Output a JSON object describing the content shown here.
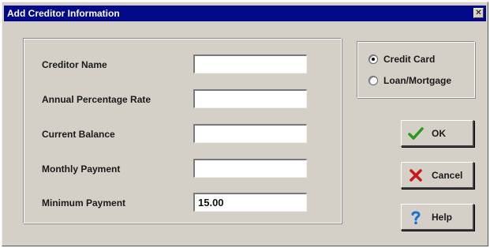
{
  "window": {
    "title": "Add Creditor Information",
    "close_glyph": "✕"
  },
  "form": {
    "creditor_name": {
      "label": "Creditor Name",
      "value": ""
    },
    "annual_percentage_rate": {
      "label": "Annual Percentage Rate",
      "value": ""
    },
    "current_balance": {
      "label": "Current Balance",
      "value": ""
    },
    "monthly_payment": {
      "label": "Monthly Payment",
      "value": ""
    },
    "minimum_payment": {
      "label": "Minimum Payment",
      "value": "15.00"
    }
  },
  "type_options": [
    {
      "label": "Credit Card",
      "selected": true
    },
    {
      "label": "Loan/Mortgage",
      "selected": false
    }
  ],
  "buttons": {
    "ok": {
      "label": "OK",
      "icon": "checkmark-icon",
      "color": "#2a9a1c"
    },
    "cancel": {
      "label": "Cancel",
      "icon": "x-mark-icon",
      "color": "#c81818"
    },
    "help": {
      "label": "Help",
      "icon": "question-mark-icon",
      "color": "#1a6fd0"
    }
  }
}
